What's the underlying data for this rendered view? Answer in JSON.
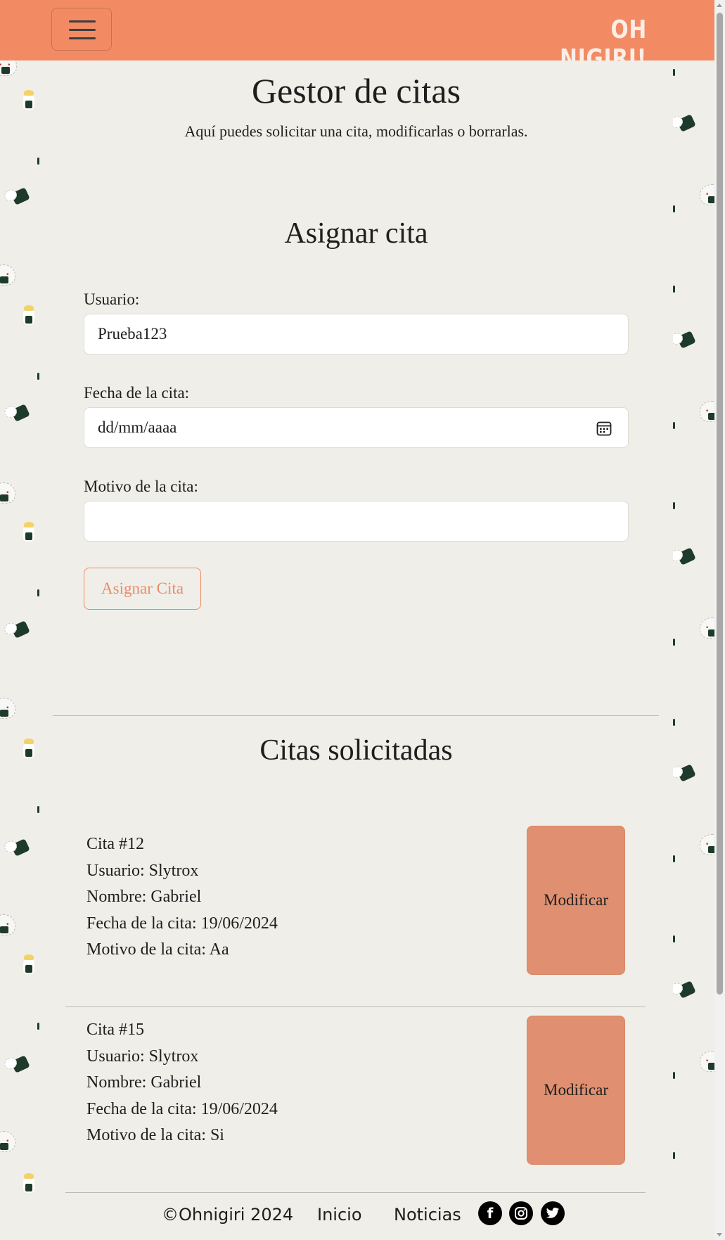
{
  "navbar": {
    "menu_icon": "hamburger-icon",
    "brand": "OH NIGIRI!",
    "color": "#f28b64"
  },
  "header": {
    "title": "Gestor de citas",
    "subtitle": "Aquí puedes solicitar una cita, modificarlas o borrarlas."
  },
  "assign": {
    "title": "Asignar cita",
    "user_label": "Usuario:",
    "user_value": "Prueba123",
    "date_label": "Fecha de la cita:",
    "date_placeholder": "dd/mm/aaaa",
    "date_icon": "calendar-icon",
    "reason_label": "Motivo de la cita:",
    "reason_value": "",
    "button": "Asignar Cita"
  },
  "requested": {
    "title": "Citas solicitadas",
    "items": [
      {
        "id": "Cita #12",
        "user": "Usuario: Slytrox",
        "name": "Nombre: Gabriel",
        "date": "Fecha de la cita: 19/06/2024",
        "reason": "Motivo de la cita: Aa",
        "button": "Modificar"
      },
      {
        "id": "Cita #15",
        "user": "Usuario: Slytrox",
        "name": "Nombre: Gabriel",
        "date": "Fecha de la cita: 19/06/2024",
        "reason": "Motivo de la cita: Si",
        "button": "Modificar"
      }
    ]
  },
  "footer": {
    "copyright": "©Ohnigiri 2024",
    "links": [
      "Inicio",
      "Noticias"
    ],
    "social_icons": [
      "facebook-icon",
      "instagram-icon",
      "twitter-icon"
    ]
  },
  "colors": {
    "accent": "#f28b64",
    "button_fill": "#e09070",
    "background": "#efeee8"
  }
}
